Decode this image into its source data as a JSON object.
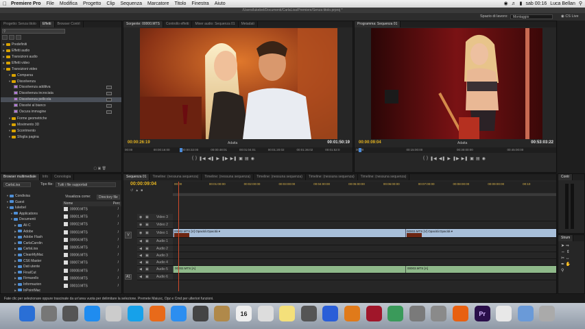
{
  "menubar": {
    "apple_icon": "apple-logo-icon",
    "app_name": "Premiere Pro",
    "items": [
      "File",
      "Modifica",
      "Progetto",
      "Clip",
      "Sequenza",
      "Marcatore",
      "Titolo",
      "Finestra",
      "Aiuto"
    ],
    "clock": "sab 00:16",
    "user": "Luca Bellan"
  },
  "title_path": "/Users/lukebel/Documenti/CarlaLisa/Premiere/Senza titolo.prproj *",
  "workspace": {
    "label": "Spazio di lavoro:",
    "value": "Montaggio",
    "cs_live": "CS Live"
  },
  "project_panel": {
    "tabs": [
      "Progetto: Senza titolo",
      "Effetti",
      "Browser Contrl"
    ],
    "active_tab": 1,
    "items": [
      {
        "label": "Predefiniti",
        "type": "folder",
        "indent": 0
      },
      {
        "label": "Effetti audio",
        "type": "folder",
        "indent": 0
      },
      {
        "label": "Transizioni audio",
        "type": "folder",
        "indent": 0
      },
      {
        "label": "Effetti video",
        "type": "folder",
        "indent": 0
      },
      {
        "label": "Transizioni video",
        "type": "folder",
        "indent": 0
      },
      {
        "label": "Comparsa",
        "type": "folder",
        "indent": 1
      },
      {
        "label": "Dissolvenza",
        "type": "folder",
        "indent": 1
      },
      {
        "label": "Dissolvenza additiva",
        "type": "fx",
        "indent": 2
      },
      {
        "label": "Dissolvenza incrociata",
        "type": "fx",
        "indent": 2
      },
      {
        "label": "Dissolvenza pellicola",
        "type": "fx",
        "indent": 2
      },
      {
        "label": "Dissolvi al bianco",
        "type": "fx",
        "indent": 2
      },
      {
        "label": "Oscura immagine",
        "type": "fx",
        "indent": 2
      },
      {
        "label": "Forme geometriche",
        "type": "folder",
        "indent": 1
      },
      {
        "label": "Movimento 3D",
        "type": "folder",
        "indent": 1
      },
      {
        "label": "Scorrimento",
        "type": "folder",
        "indent": 1
      },
      {
        "label": "Sfoglia pagina",
        "type": "folder",
        "indent": 1
      }
    ]
  },
  "source_monitor": {
    "tabs": [
      "Sorgente: 00000.MTS",
      "Controllo effetti",
      "Mixer audio: Sequenza 01",
      "Metadati"
    ],
    "timecode_current": "00:00:26:19",
    "timecode_duration": "00:01:50:19",
    "fit": "Adatta",
    "ruler": [
      "00:00",
      "00:00:16:00",
      "00:00:32:00",
      "00:00:48:01",
      "00:01:04:01",
      "00:01:20:02",
      "00:01:36:02",
      "00:01:52:0"
    ]
  },
  "program_monitor": {
    "tabs": [
      "Programma: Sequenza 01"
    ],
    "timecode_current": "00:00:09:04",
    "timecode_duration": "00:53:03:22",
    "fit": "Adatta",
    "ruler": [
      "00:00",
      "00:15:00:00",
      "00:30:00:00",
      "00:45:00:00"
    ]
  },
  "media_browser": {
    "tabs": [
      "Browser multimediale",
      "Info",
      "Cronologia"
    ],
    "drive": "CarlaLisa",
    "file_type_label": "Tipo file:",
    "file_type_value": "Tutti i file supportati",
    "view_label": "Visualizza come:",
    "view_value": "Directory file",
    "col_name": "Nome",
    "col_perc": "Perc",
    "tree": [
      "Condivisa",
      "Guest",
      "lukebel",
      "Applications",
      "Documenti",
      "Ali C",
      "Adobe",
      "Adobe Flash",
      "CarlaCarolin",
      "CarlaLisa",
      "CleanMyMac",
      "CS6 Master",
      "Dati utente",
      "FinalCut",
      "Firmarello",
      "Informazion",
      "InPointMac"
    ],
    "files": [
      "00000.MTS",
      "00001.MTS",
      "00002.MTS",
      "00003.MTS",
      "00004.MTS",
      "00005.MTS",
      "00006.MTS",
      "00007.MTS",
      "00008.MTS",
      "00009.MTS",
      "00010.MTS"
    ]
  },
  "timeline": {
    "tabs": [
      "Sequenza 01",
      "Timeline: (nessuna sequenza)",
      "Timeline: (nessuna sequenza)",
      "Timeline: (nessuna sequenza)",
      "Timeline: (nessuna sequenza)",
      "Timeline: (nessuna sequenza)"
    ],
    "timecode": "00:00:09:04",
    "ruler": [
      "00:00",
      "00:01:00:00",
      "00:02:00:00",
      "00:03:00:00",
      "00:04:00:00",
      "00:05:00:00",
      "00:06:00:00",
      "00:07:00:00",
      "00:08:00:00",
      "00:09:00:00",
      "00:10"
    ],
    "tracks": [
      {
        "name": "Video 3",
        "kind": "video"
      },
      {
        "name": "Video 2",
        "kind": "video"
      },
      {
        "name": "Video 1",
        "kind": "video-main"
      },
      {
        "name": "Audio 1",
        "kind": "audio"
      },
      {
        "name": "Audio 2",
        "kind": "audio"
      },
      {
        "name": "Audio 3",
        "kind": "audio"
      },
      {
        "name": "Audio 4",
        "kind": "audio"
      },
      {
        "name": "Audio 5",
        "kind": "audio-main"
      },
      {
        "name": "Audio 6",
        "kind": "audio"
      }
    ],
    "video_clips": [
      "00002.MTS [V]  Opacità:Opacità ▾",
      "00003.MTS [V]  Opacità:Opacità ▾"
    ],
    "audio_clips": [
      "00002.MTS [A]",
      "00003.MTS [A]"
    ],
    "track_labels": {
      "v": "V",
      "a1": "A1"
    }
  },
  "audio_meters": {
    "label": "Contr"
  },
  "tools": {
    "label": "Strum"
  },
  "status_bar": "Fate clic per selezionare oppure trascinate da un'area vuota per delimitare la selezione. Premete Maiusc, Opz e Cmd per ulteriori funzioni.",
  "dock": {
    "apps": [
      "finder-icon",
      "launchpad-icon",
      "mission-control-icon",
      "app-store-icon",
      "preview-icon",
      "skype-icon",
      "firefox-icon",
      "safari-icon",
      "facetime-icon",
      "contacts-icon",
      "calendar-icon",
      "reminders-icon",
      "notes-icon",
      "system-tools-icon",
      "itunes-icon",
      "ibooks-icon",
      "photo-booth-icon",
      "photos-icon",
      "image-capture-icon",
      "system-preferences-icon",
      "vlc-icon",
      "premiere-icon",
      "document-icon",
      "downloads-icon",
      "trash-icon"
    ],
    "calendar_day": "16",
    "premiere_label": "Pr"
  },
  "colors": {
    "accent": "#e8b620",
    "video_clip": "#a8bfd9",
    "audio_clip": "#8fb98a",
    "panel": "#262626"
  }
}
